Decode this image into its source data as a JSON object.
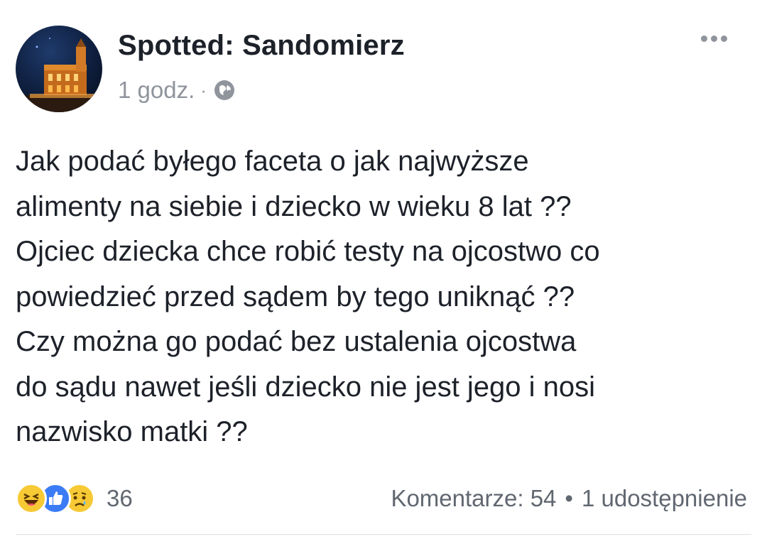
{
  "post": {
    "author": "Spotted: Sandomierz",
    "time": "1 godz.",
    "separator": "·",
    "privacy_icon": "globe-icon",
    "menu_icon": "more-options-icon",
    "text_lines": [
      "Jak podać byłego faceta o jak najwyższe",
      "alimenty na siebie i dziecko w wieku 8 lat ??",
      "Ojciec dziecka chce robić testy na ojcostwo co",
      "powiedzieć przed sądem by tego uniknąć ??",
      "Czy można go podać bez ustalenia ojcostwa",
      "do sądu nawet jeśli dziecko nie jest jego i nosi",
      "nazwisko matki ??"
    ]
  },
  "reactions": {
    "icons": [
      "haha-reaction-icon",
      "like-reaction-icon",
      "sad-reaction-icon"
    ],
    "count": "36"
  },
  "stats": {
    "comments": "Komentarze: 54",
    "dot": "•",
    "shares": "1 udostępnienie"
  },
  "colors": {
    "text": "#1d2129",
    "meta": "#90949c",
    "like_blue": "#3b7bf5",
    "haha_yellow": "#f7c935"
  }
}
